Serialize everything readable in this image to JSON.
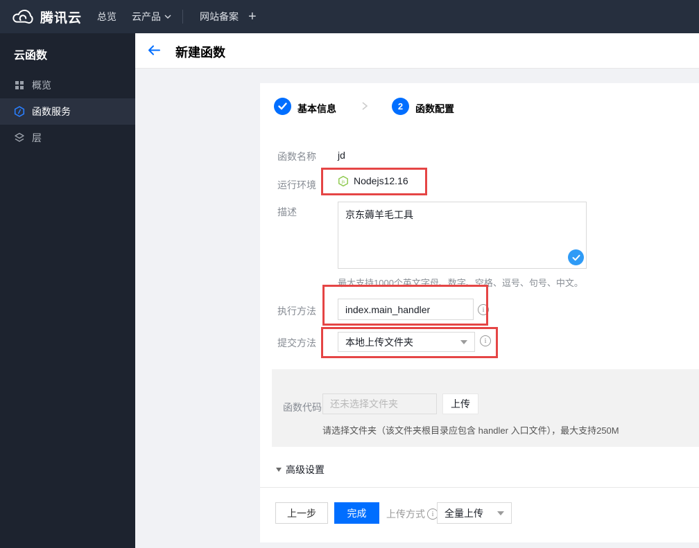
{
  "topbar": {
    "brand": "腾讯云",
    "nav_overview": "总览",
    "nav_products": "云产品",
    "nav_icp": "网站备案",
    "nav_plus": "+"
  },
  "sidebar": {
    "title": "云函数",
    "items": [
      {
        "label": "概览",
        "icon": "grid-icon",
        "active": false
      },
      {
        "label": "函数服务",
        "icon": "function-hexagon-icon",
        "active": true
      },
      {
        "label": "层",
        "icon": "layers-icon",
        "active": false
      }
    ]
  },
  "header": {
    "title": "新建函数"
  },
  "steps": {
    "step1_label": "基本信息",
    "step1_state": "done",
    "step2_num": "2",
    "step2_label": "函数配置",
    "step2_state": "current"
  },
  "form": {
    "name_label": "函数名称",
    "name_value": "jd",
    "runtime_label": "运行环境",
    "runtime_value": "Nodejs12.16",
    "desc_label": "描述",
    "desc_value": "京东薅羊毛工具",
    "desc_help": "最大支持1000个英文字母、数字、空格、逗号、句号、中文。",
    "handler_label": "执行方法",
    "handler_value": "index.main_handler",
    "submit_label": "提交方法",
    "submit_value": "本地上传文件夹",
    "code_label": "函数代码",
    "code_required": "*",
    "code_placeholder": "还未选择文件夹",
    "upload_button": "上传",
    "code_help": "请选择文件夹（该文件夹根目录应包含 handler 入口文件），最大支持250M",
    "advanced_label": "高级设置"
  },
  "footer": {
    "prev_button": "上一步",
    "finish_button": "完成",
    "upload_mode_label": "上传方式",
    "upload_mode_value": "全量上传"
  },
  "colors": {
    "accent": "#006eff",
    "annotation": "#e54545",
    "node_green": "#8cc84b",
    "topbar": "#262f3e",
    "sidebar": "#1d232f",
    "check_blue": "#2f9bf6"
  }
}
